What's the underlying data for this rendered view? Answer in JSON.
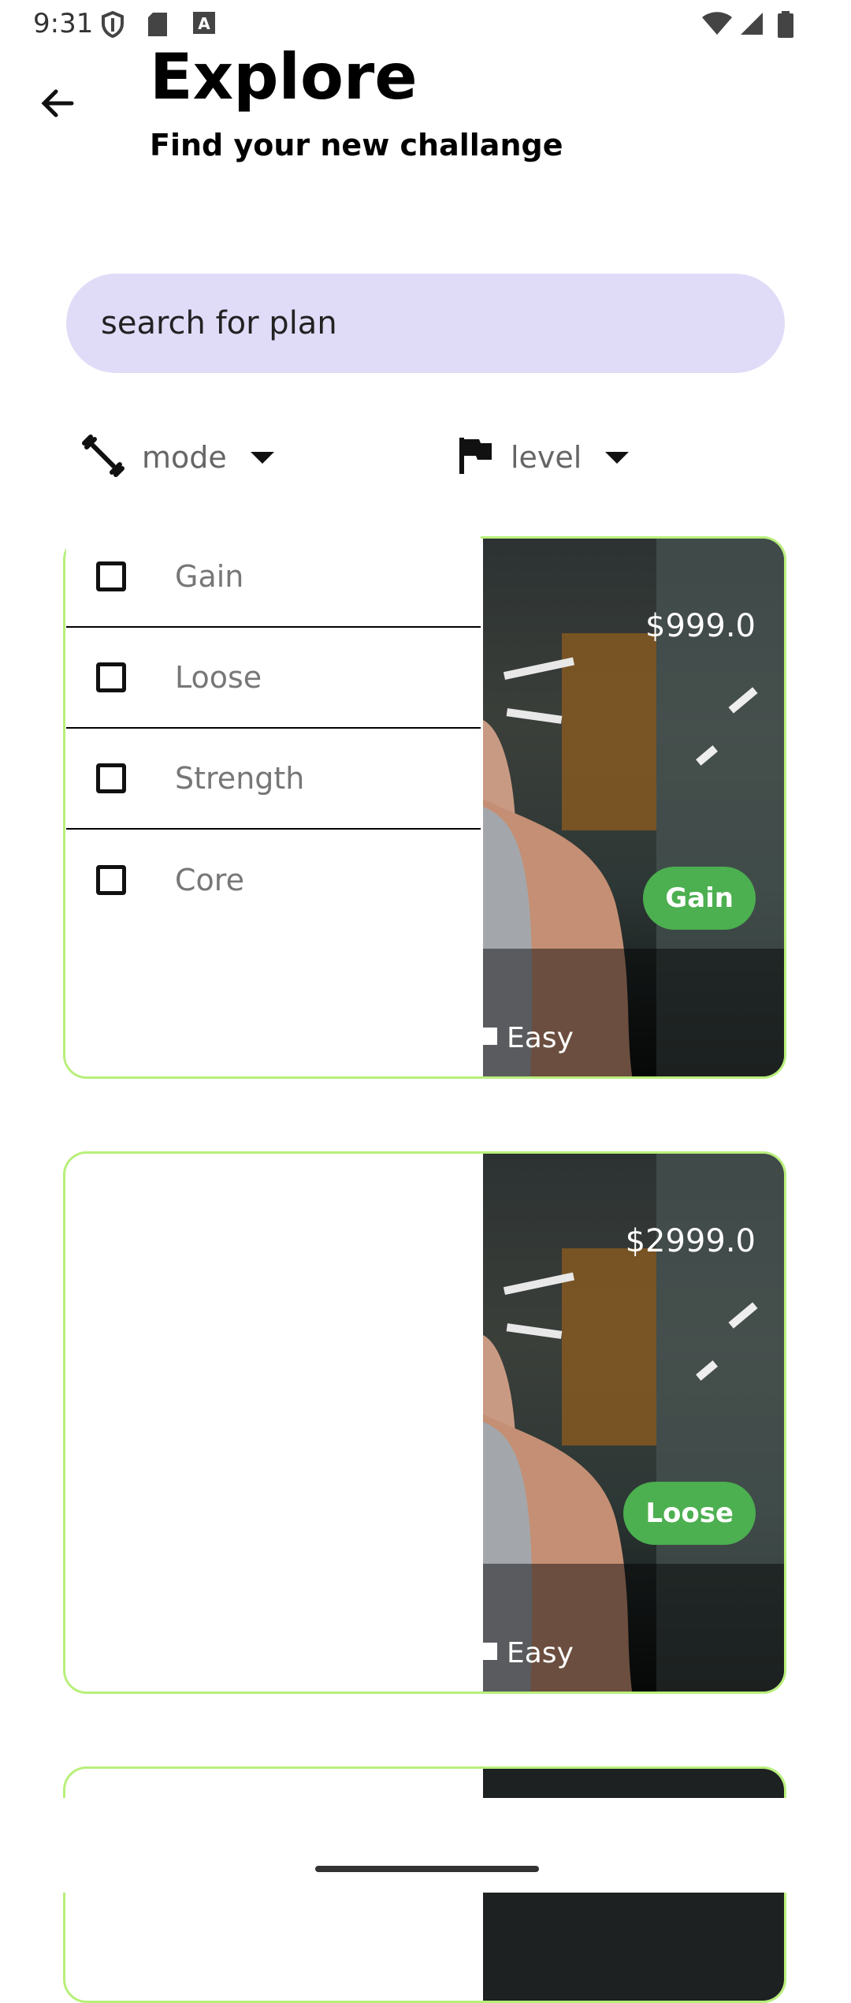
{
  "status_bar": {
    "time": "9:31",
    "icons": [
      "shield-icon",
      "sd-card-icon",
      "a-icon",
      "wifi-icon",
      "signal-icon",
      "battery-icon"
    ]
  },
  "header": {
    "back_icon": "arrow-back-icon",
    "title": "Explore",
    "subtitle": "Find your new challange"
  },
  "search": {
    "placeholder": "search for plan",
    "value": ""
  },
  "filters": {
    "mode": {
      "label": "mode",
      "icon": "dumbbell-icon"
    },
    "level": {
      "label": "level",
      "icon": "flag-icon"
    }
  },
  "mode_options": [
    {
      "label": "Gain",
      "checked": false
    },
    {
      "label": "Loose",
      "checked": false
    },
    {
      "label": "Strength",
      "checked": false
    },
    {
      "label": "Core",
      "checked": false
    }
  ],
  "plans": [
    {
      "price": "$999.0",
      "mode": "Gain",
      "level": "Easy"
    },
    {
      "price": "$2999.0",
      "mode": "Loose",
      "level": "Easy"
    }
  ],
  "colors": {
    "search_bg": "#e0dcf8",
    "card_border": "#b8ef7a",
    "badge_bg": "#4caf50"
  }
}
